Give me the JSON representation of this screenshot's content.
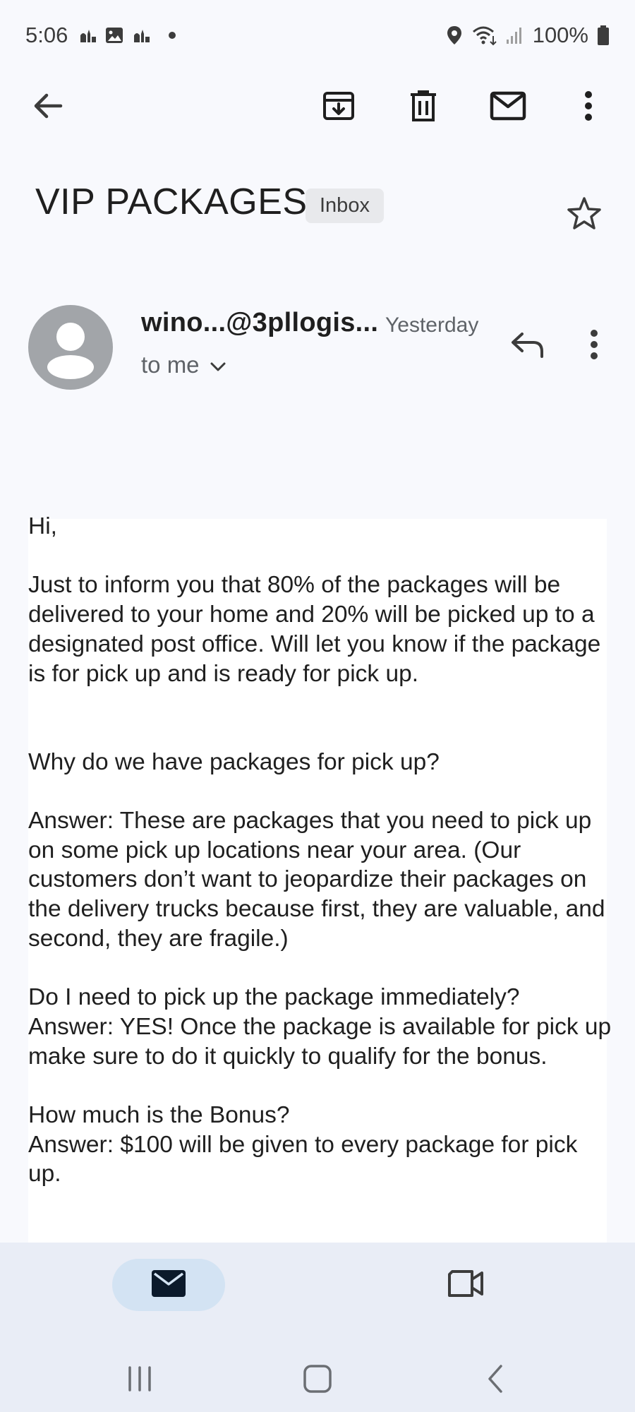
{
  "status_bar": {
    "time": "5:06",
    "battery": "100%",
    "notification_icons": [
      "mosque-icon",
      "image-icon",
      "mosque-icon",
      "dot-icon"
    ],
    "right_icons": [
      "location-icon",
      "wifi-icon",
      "signal-icon",
      "battery-icon"
    ]
  },
  "toolbar": {
    "back_icon": "arrow-back-icon",
    "archive_icon": "archive-icon",
    "delete_icon": "trash-icon",
    "mark_unread_icon": "mail-icon",
    "more_icon": "more-vert-icon"
  },
  "email": {
    "subject": "VIP PACKAGES",
    "label": "Inbox",
    "sender": "wino...@3pllogis...",
    "date": "Yesterday",
    "recipient": "to me",
    "body": "Hi,\n\nJust to inform you that 80% of the packages will be delivered to your home and 20% will be picked up to a designated post office. Will let you know if the package is for pick up and is ready for pick up.\n\n\nWhy do we have packages for pick up?\n\nAnswer: These are packages that you need to pick up on some pick up locations near your area. (Our customers don’t want to jeopardize their packages on the delivery trucks because first, they are valuable, and second, they are fragile.)\n\nDo I need to pick up the package immediately?\nAnswer: YES! Once the package is available for pick up make sure to do it quickly to qualify for the bonus.\n\nHow much is the Bonus?\nAnswer: $100 will be given to every package for pick up."
  },
  "bottom_nav": {
    "items": [
      {
        "icon": "mail-icon",
        "selected": true
      },
      {
        "icon": "video-camera-icon",
        "selected": false
      }
    ]
  },
  "colors": {
    "background": "#f8f9fd",
    "nav_background": "#e9edf6",
    "nav_selected": "#d3e3f3",
    "avatar": "#a2a5a9",
    "chip": "#e8e9ec"
  }
}
